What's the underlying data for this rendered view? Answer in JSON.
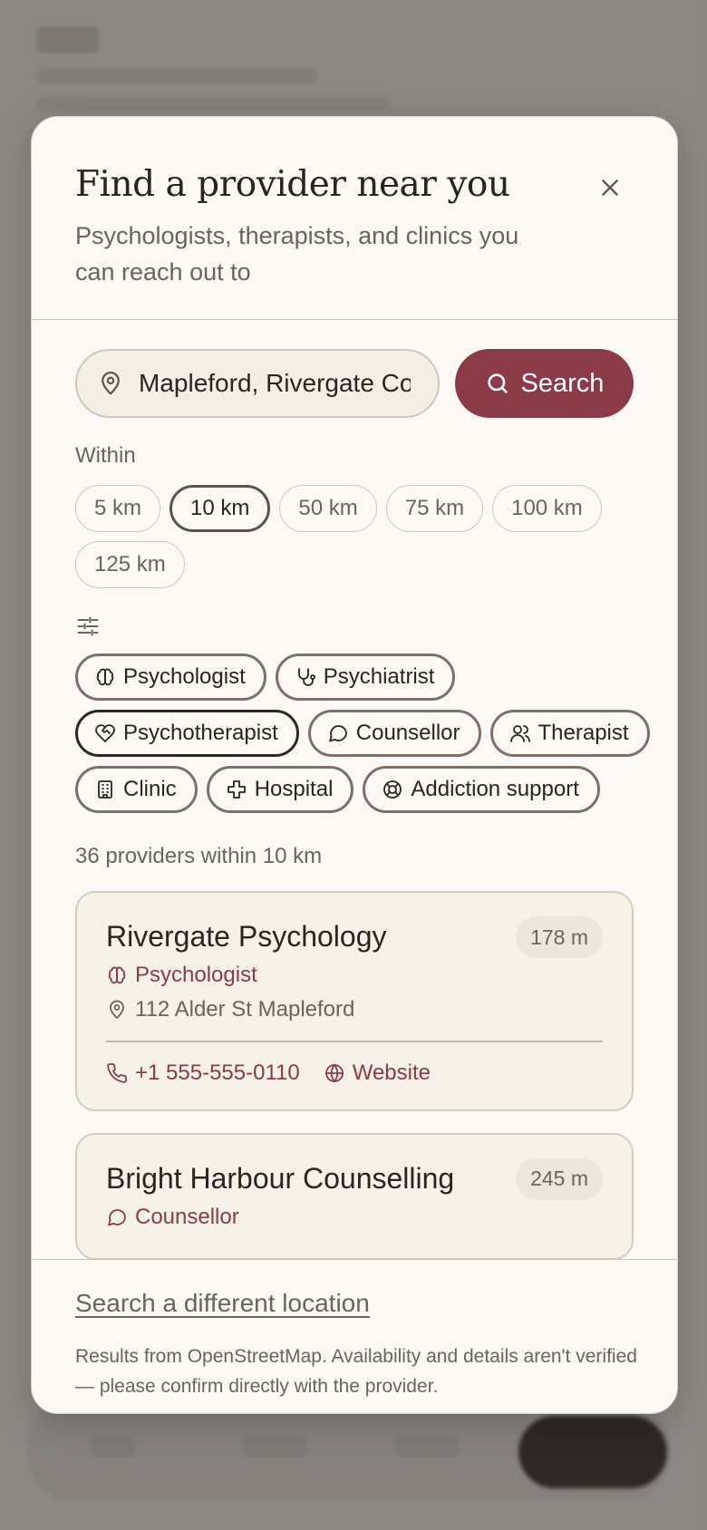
{
  "modal": {
    "title": "Find a provider near you",
    "subtitle": "Psychologists, therapists, and clinics you can reach out to"
  },
  "search": {
    "location_value": "Mapleford, Rivergate Co",
    "button_label": "Search"
  },
  "radius": {
    "label": "Within",
    "options": [
      "5 km",
      "10 km",
      "50 km",
      "75 km",
      "100 km",
      "125 km"
    ],
    "selected": "10 km"
  },
  "types": [
    {
      "label": "Psychologist",
      "icon": "brain-icon"
    },
    {
      "label": "Psychiatrist",
      "icon": "stethoscope-icon"
    },
    {
      "label": "Psychotherapist",
      "icon": "heart-handshake-icon",
      "active": true
    },
    {
      "label": "Counsellor",
      "icon": "message-circle-icon"
    },
    {
      "label": "Therapist",
      "icon": "users-icon"
    },
    {
      "label": "Clinic",
      "icon": "building-icon"
    },
    {
      "label": "Hospital",
      "icon": "cross-icon"
    },
    {
      "label": "Addiction support",
      "icon": "life-buoy-icon"
    }
  ],
  "results": {
    "count_text": "36 providers within 10 km",
    "providers": [
      {
        "name": "Rivergate Psychology",
        "distance": "178 m",
        "type": "Psychologist",
        "address": "112 Alder St Mapleford",
        "phone": "+1 555-555-0110",
        "website_label": "Website"
      },
      {
        "name": "Bright Harbour Counselling",
        "distance": "245 m",
        "type": "Counsellor"
      }
    ]
  },
  "footer": {
    "link": "Search a different location",
    "note": "Results from OpenStreetMap. Availability and details aren't verified — please confirm directly with the provider."
  },
  "colors": {
    "accent": "#8a3b47",
    "surface": "#fcf9f4",
    "card": "#f6f2e8"
  }
}
